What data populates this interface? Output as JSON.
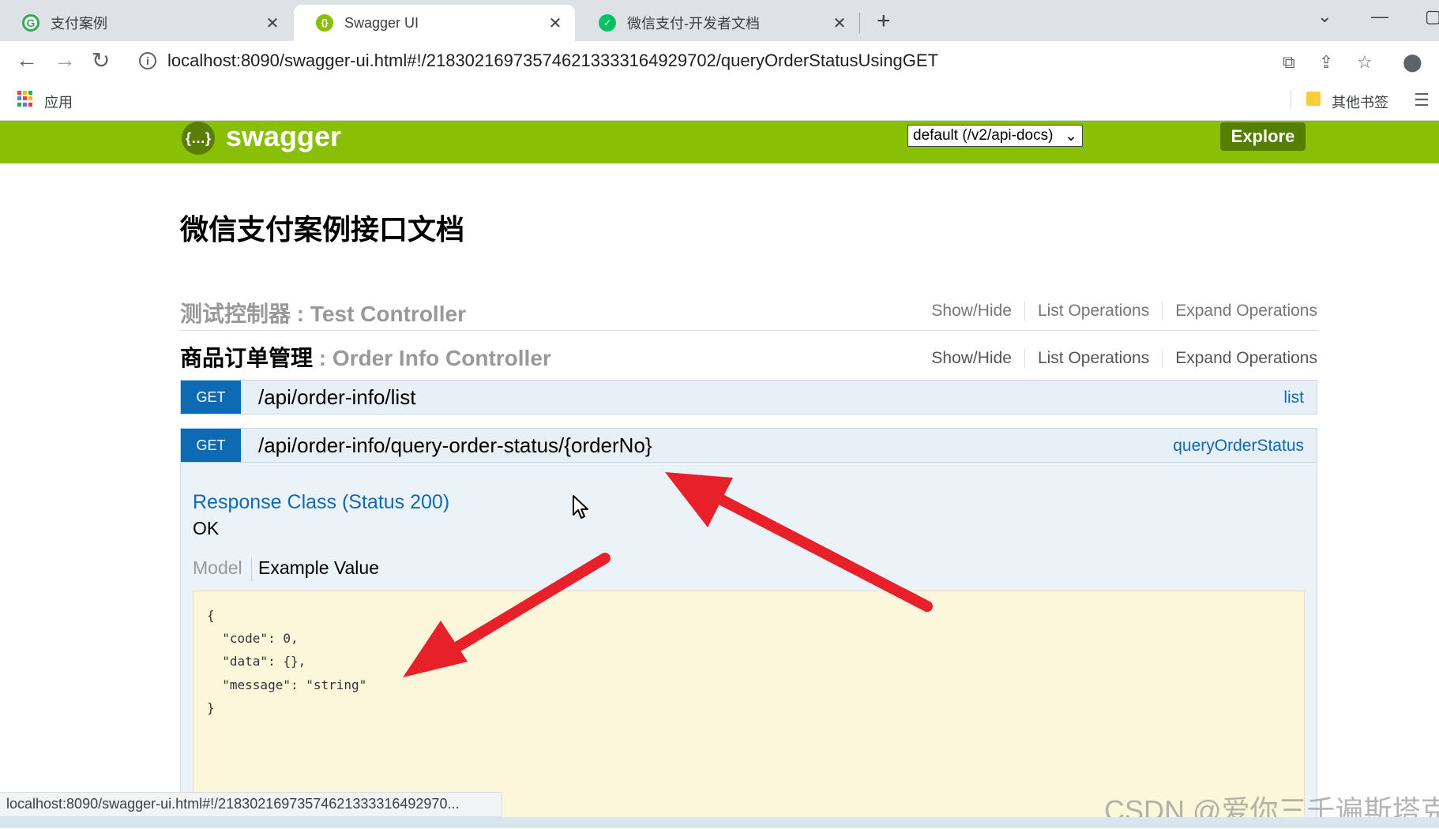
{
  "browser": {
    "tabs": [
      {
        "title": "支付案例",
        "active": false,
        "favicon_color": "#34a853"
      },
      {
        "title": "Swagger UI",
        "active": true,
        "favicon_color": "#89bf04"
      },
      {
        "title": "微信支付-开发者文档",
        "active": false,
        "favicon_color": "#07c160"
      }
    ],
    "url": "localhost:8090/swagger-ui.html#!/218302169735746213333164929702/queryOrderStatusUsingGET",
    "bookmarks": {
      "apps_label": "应用",
      "other_label": "其他书签"
    },
    "status_url": "localhost:8090/swagger-ui.html#!/2183021697357462133331649297​0..."
  },
  "swagger": {
    "logo_glyph": "{…}",
    "title": "swagger",
    "spec_select": "default (/v2/api-docs)",
    "explore_label": "Explore"
  },
  "page": {
    "title": "微信支付案例接口文档"
  },
  "controllers": [
    {
      "name_cn": "测试控制器",
      "name_en": "Test Controller",
      "ops": [
        "Show/Hide",
        "List Operations",
        "Expand Operations"
      ]
    },
    {
      "name_cn": "商品订单管理",
      "name_en": "Order Info Controller",
      "ops": [
        "Show/Hide",
        "List Operations",
        "Expand Operations"
      ]
    }
  ],
  "operations": [
    {
      "method": "GET",
      "path": "/api/order-info/list",
      "nickname": "list"
    },
    {
      "method": "GET",
      "path": "/api/order-info/query-order-status/{orderNo}",
      "nickname": "queryOrderStatus"
    }
  ],
  "response": {
    "title": "Response Class (Status 200)",
    "status_text": "OK",
    "tab_model": "Model",
    "tab_example": "Example Value",
    "code_lines": [
      "{",
      "  \"code\": 0,",
      "  \"data\": {},",
      "  \"message\": \"string\"",
      "}"
    ]
  },
  "watermark": "CSDN @爱你三千遍斯塔克",
  "colors": {
    "swagger_green": "#89bf04",
    "get_blue": "#0f6ab4",
    "annotation_red": "#e8202a"
  }
}
